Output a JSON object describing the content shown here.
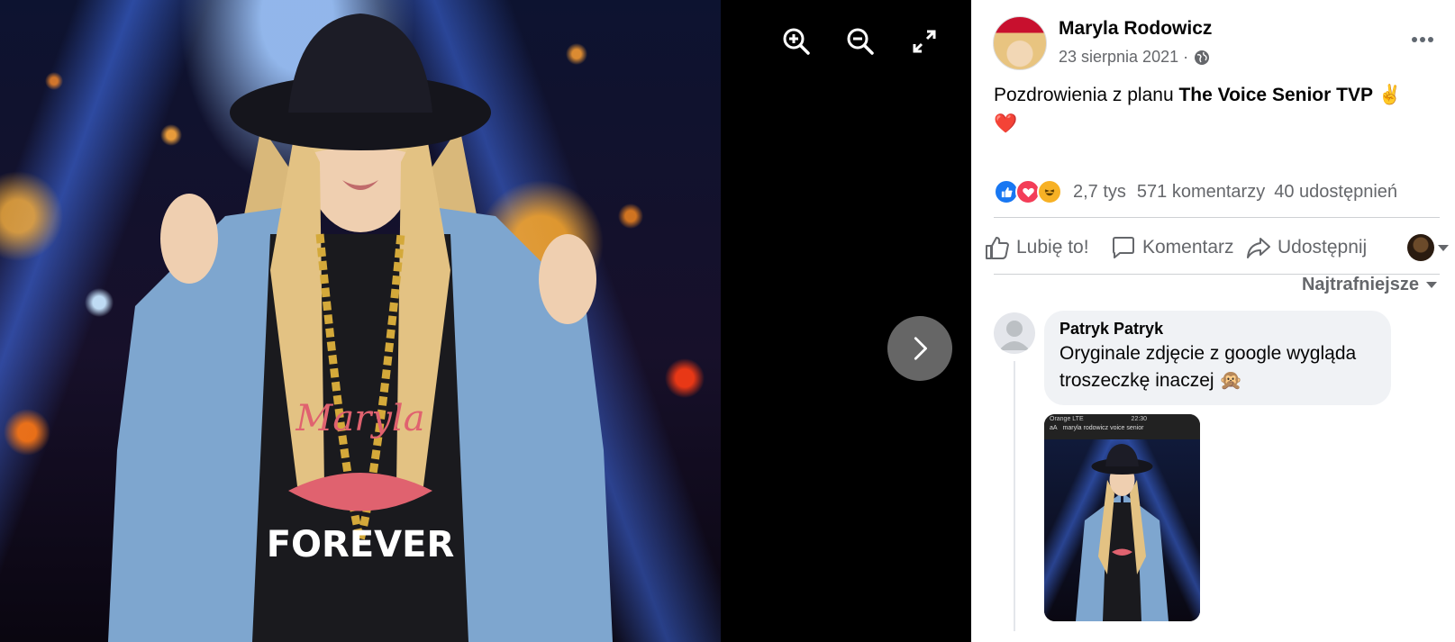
{
  "viewer": {
    "shirt_brand": "Maryla",
    "shirt_slogan": "FOREVER"
  },
  "post": {
    "author": "Maryla Rodowicz",
    "date": "23 sierpnia 2021 ·",
    "text_prefix": "Pozdrowienia z planu ",
    "text_bold": "The Voice Senior TVP",
    "text_emoji": " ✌️",
    "text_line2": "❤️"
  },
  "reactions": {
    "count": "2,7 tys",
    "comments": "571 komentarzy",
    "shares": "40 udostępnień"
  },
  "actions": {
    "like": "Lubię to!",
    "comment": "Komentarz",
    "share": "Udostępnij"
  },
  "sort": {
    "label": "Najtrafniejsze"
  },
  "comment": {
    "author": "Patryk Patryk",
    "text": "Oryginale zdjęcie z google wygląda troszeczkę inaczej 🙊",
    "image": {
      "carrier": "Orange LTE",
      "time": "22:30",
      "aa": "aA",
      "url": "maryla rodowicz voice senior"
    }
  },
  "colors": {
    "accent": "#1877f2",
    "love": "#f33e58",
    "haha": "#f7b125",
    "secondary_text": "#65676b"
  }
}
